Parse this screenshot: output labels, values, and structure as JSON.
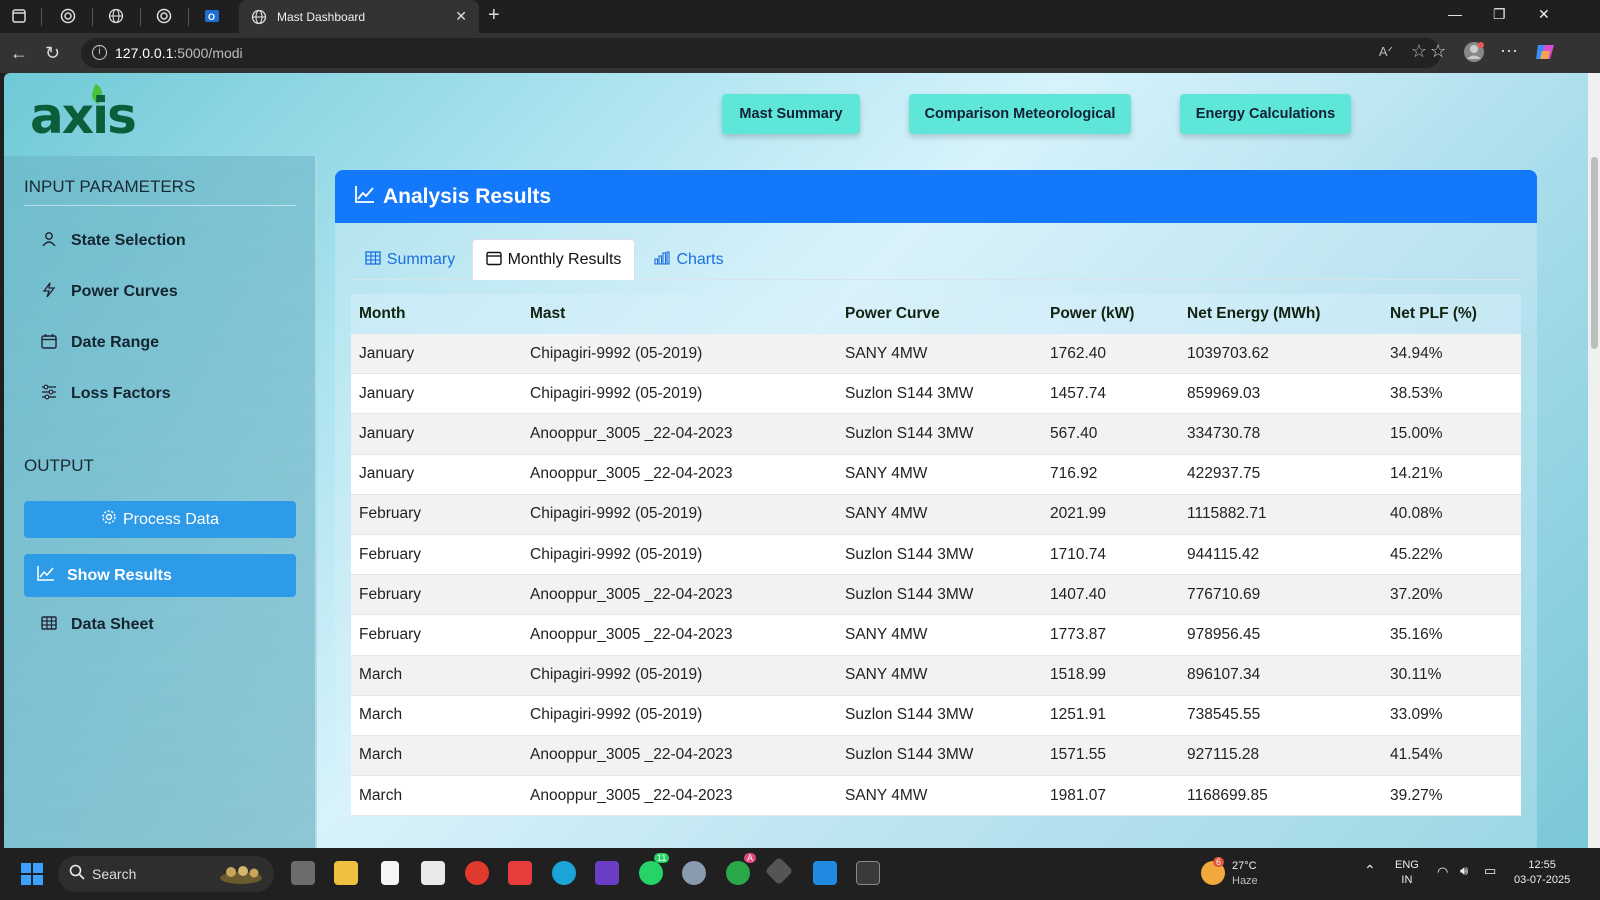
{
  "browser": {
    "tab_title": "Mast Dashboard",
    "url_host": "127.0.0.1",
    "url_rest": ":5000/modi",
    "icons": [
      "sidebar-toggle-icon",
      "tab-favicon-icon",
      "globe-icon",
      "tab-favicon-icon",
      "outlook-icon"
    ]
  },
  "header": {
    "logo_text": "axis",
    "buttons": [
      {
        "label": "Mast Summary"
      },
      {
        "label": "Comparison Meteorological"
      },
      {
        "label": "Energy Calculations"
      }
    ]
  },
  "sidebar": {
    "input_title": "INPUT PARAMETERS",
    "input_items": [
      {
        "label": "State Selection",
        "icon": "user-icon"
      },
      {
        "label": "Power Curves",
        "icon": "bolt-icon"
      },
      {
        "label": "Date Range",
        "icon": "calendar-icon"
      },
      {
        "label": "Loss Factors",
        "icon": "sliders-icon"
      }
    ],
    "output_title": "OUTPUT",
    "process_label": "Process Data",
    "show_results_label": "Show Results",
    "data_sheet_label": "Data Sheet"
  },
  "panel": {
    "title": "Analysis Results",
    "tabs": [
      {
        "label": "Summary",
        "active": false
      },
      {
        "label": "Monthly Results",
        "active": true
      },
      {
        "label": "Charts",
        "active": false
      }
    ]
  },
  "table": {
    "headers": [
      "Month",
      "Mast",
      "Power Curve",
      "Power (kW)",
      "Net Energy (MWh)",
      "Net PLF (%)"
    ],
    "rows": [
      [
        "January",
        "Chipagiri-9992 (05-2019)",
        "SANY 4MW",
        "1762.40",
        "1039703.62",
        "34.94%"
      ],
      [
        "January",
        "Chipagiri-9992 (05-2019)",
        "Suzlon S144 3MW",
        "1457.74",
        "859969.03",
        "38.53%"
      ],
      [
        "January",
        "Anooppur_3005 _22-04-2023",
        "Suzlon S144 3MW",
        "567.40",
        "334730.78",
        "15.00%"
      ],
      [
        "January",
        "Anooppur_3005 _22-04-2023",
        "SANY 4MW",
        "716.92",
        "422937.75",
        "14.21%"
      ],
      [
        "February",
        "Chipagiri-9992 (05-2019)",
        "SANY 4MW",
        "2021.99",
        "1115882.71",
        "40.08%"
      ],
      [
        "February",
        "Chipagiri-9992 (05-2019)",
        "Suzlon S144 3MW",
        "1710.74",
        "944115.42",
        "45.22%"
      ],
      [
        "February",
        "Anooppur_3005 _22-04-2023",
        "Suzlon S144 3MW",
        "1407.40",
        "776710.69",
        "37.20%"
      ],
      [
        "February",
        "Anooppur_3005 _22-04-2023",
        "SANY 4MW",
        "1773.87",
        "978956.45",
        "35.16%"
      ],
      [
        "March",
        "Chipagiri-9992 (05-2019)",
        "SANY 4MW",
        "1518.99",
        "896107.34",
        "30.11%"
      ],
      [
        "March",
        "Chipagiri-9992 (05-2019)",
        "Suzlon S144 3MW",
        "1251.91",
        "738545.55",
        "33.09%"
      ],
      [
        "March",
        "Anooppur_3005 _22-04-2023",
        "Suzlon S144 3MW",
        "1571.55",
        "927115.28",
        "41.54%"
      ],
      [
        "March",
        "Anooppur_3005 _22-04-2023",
        "SANY 4MW",
        "1981.07",
        "1168699.85",
        "39.27%"
      ]
    ]
  },
  "taskbar": {
    "search_placeholder": "Search",
    "weather_temp": "27°C",
    "weather_desc": "Haze",
    "weather_badge": "6",
    "lang_top": "ENG",
    "lang_bottom": "IN",
    "time": "12:55",
    "date": "03-07-2025",
    "whatsapp_badge": "11",
    "chrome_badge": "A"
  },
  "colors": {
    "accent": "#1478fb",
    "sidebar_button": "#2d9be8",
    "top_button": "#5ee6d8",
    "logo": "#0b5e3a"
  }
}
